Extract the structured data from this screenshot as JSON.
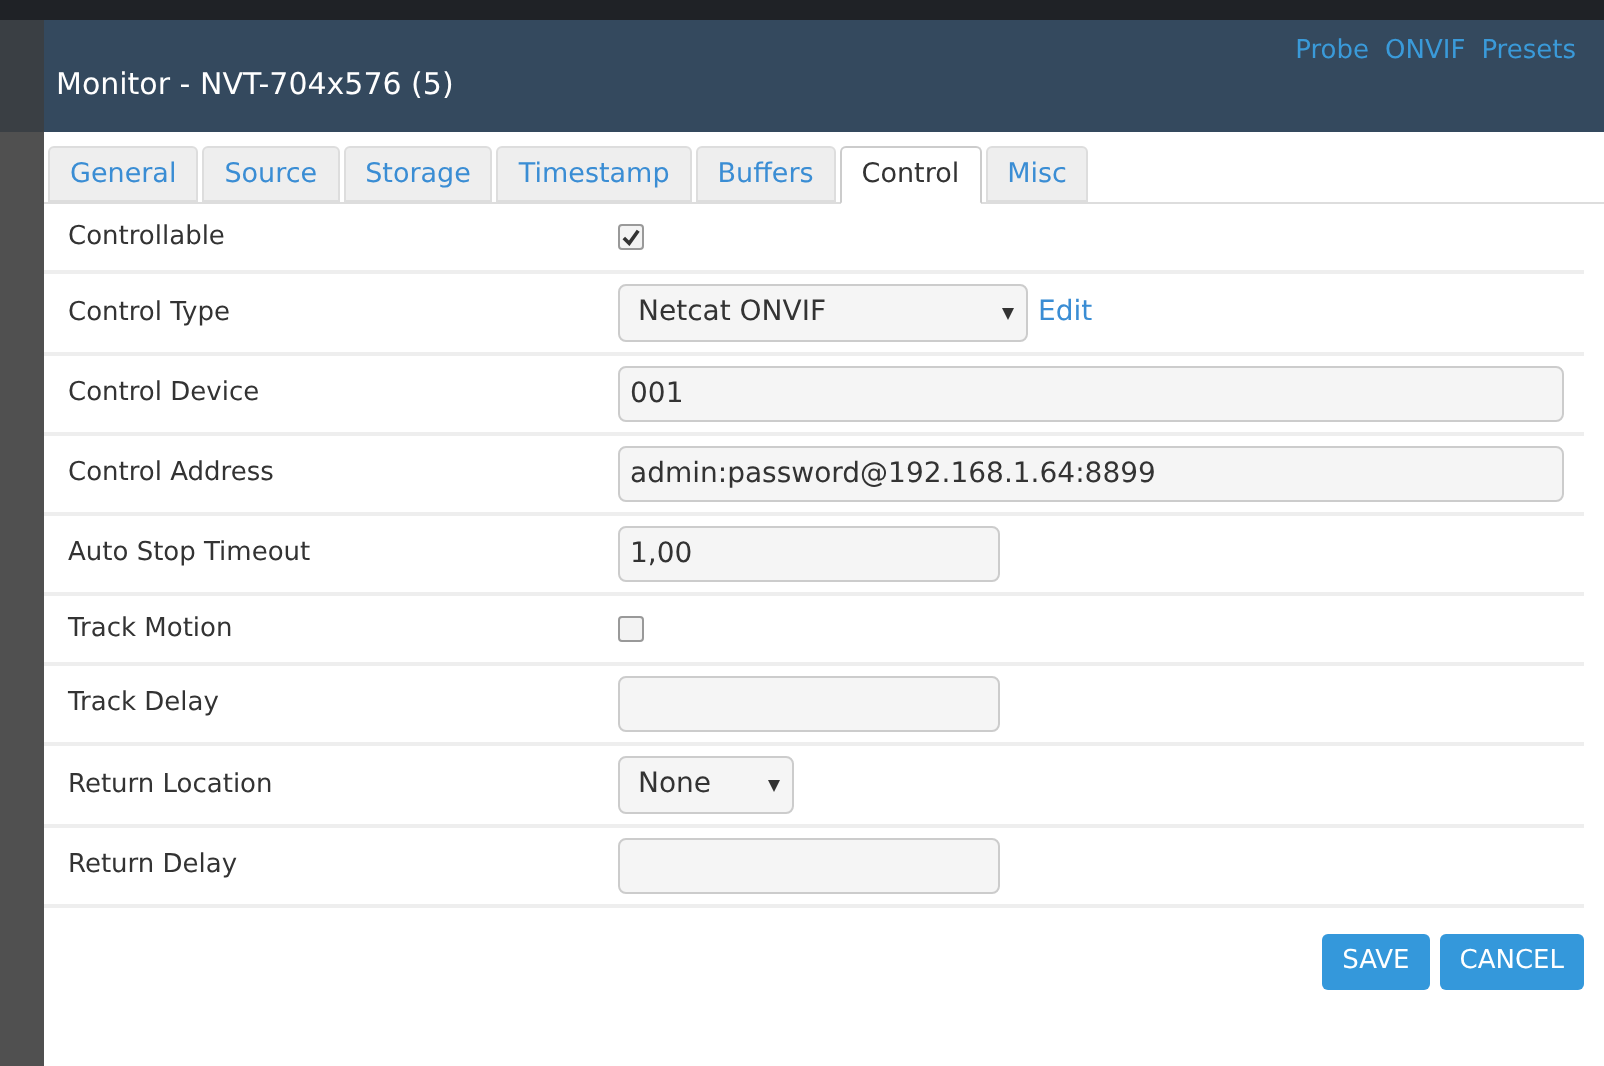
{
  "header": {
    "title": "Monitor - NVT-704x576 (5)",
    "links": [
      "Probe",
      "ONVIF",
      "Presets"
    ]
  },
  "tabs": [
    {
      "label": "General",
      "selected": false
    },
    {
      "label": "Source",
      "selected": false
    },
    {
      "label": "Storage",
      "selected": false
    },
    {
      "label": "Timestamp",
      "selected": false
    },
    {
      "label": "Buffers",
      "selected": false
    },
    {
      "label": "Control",
      "selected": true
    },
    {
      "label": "Misc",
      "selected": false
    }
  ],
  "rows": [
    {
      "label": "Controllable",
      "kind": "checkbox",
      "checked": true
    },
    {
      "label": "Control Type",
      "kind": "select",
      "value": "Netcat ONVIF",
      "link": "Edit"
    },
    {
      "label": "Control Device",
      "kind": "text",
      "value": "001"
    },
    {
      "label": "Control Address",
      "kind": "text",
      "value": "admin:password@192.168.1.64:8899"
    },
    {
      "label": "Auto Stop Timeout",
      "kind": "text",
      "value": "1,00"
    },
    {
      "label": "Track Motion",
      "kind": "checkbox",
      "checked": false
    },
    {
      "label": "Track Delay",
      "kind": "text"
    },
    {
      "label": "Return Location",
      "kind": "select",
      "value": "None"
    },
    {
      "label": "Return Delay",
      "kind": "text"
    }
  ],
  "buttons": [
    "SAVE",
    "CANCEL"
  ]
}
